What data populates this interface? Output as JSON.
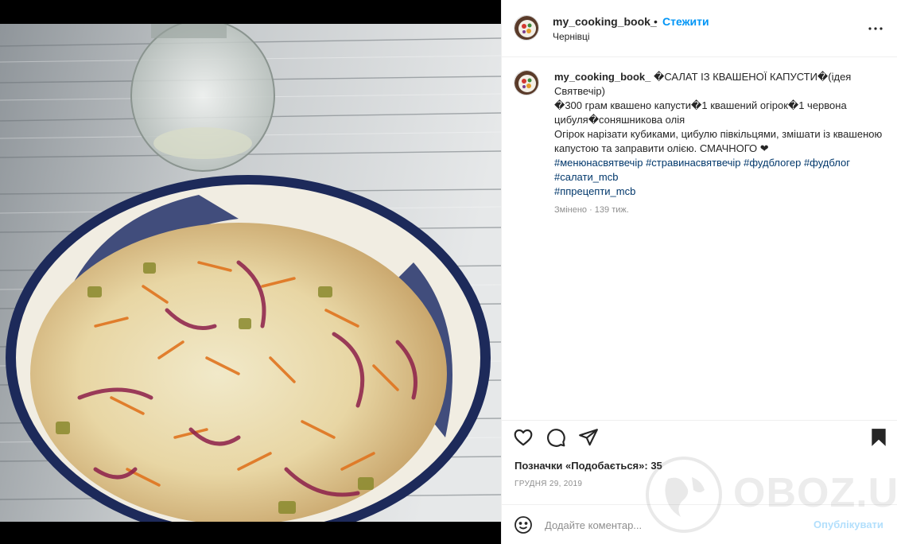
{
  "post": {
    "username": "my_cooking_book_",
    "separator": "•",
    "follow_label": "Стежити",
    "location": "Чернівці"
  },
  "caption": {
    "username": "my_cooking_book_",
    "title_line": "�САЛАТ ІЗ КВАШЕНОЇ КАПУСТИ�(ідея Святвечір)",
    "ingredients": "�300 грам квашено капусти�1 квашений огірок�1 червона цибуля�соняшникова олія",
    "method": "Огірок нарізати кубиками, цибулю півкільцями, змішати із квашеною капустою та заправити олією. СМАЧНОГО ❤",
    "hashtags": [
      "#менюнасвятвечір",
      "#стравинасвятвечір",
      "#фудблогер",
      "#фудблог",
      "#салати_mcb",
      "#ппрецепти_mcb"
    ],
    "edited": "Змінено · 139 тиж."
  },
  "engagement": {
    "likes_label": "Позначки «Подобається»:",
    "likes_count": "35",
    "date": "ГРУДНЯ 29, 2019"
  },
  "comment_box": {
    "placeholder": "Додайте коментар...",
    "publish_label": "Опублікувати"
  },
  "icons": {
    "more": "more-options-icon",
    "like": "heart-icon",
    "comment": "comment-icon",
    "share": "share-icon",
    "save": "bookmark-icon",
    "emoji": "emoji-icon"
  },
  "colors": {
    "accent": "#0095f6",
    "hashtag": "#00376b",
    "muted": "#8e8e8e",
    "publish_disabled": "#b2dffc"
  },
  "watermark": {
    "text": "OBOZ.UA"
  }
}
